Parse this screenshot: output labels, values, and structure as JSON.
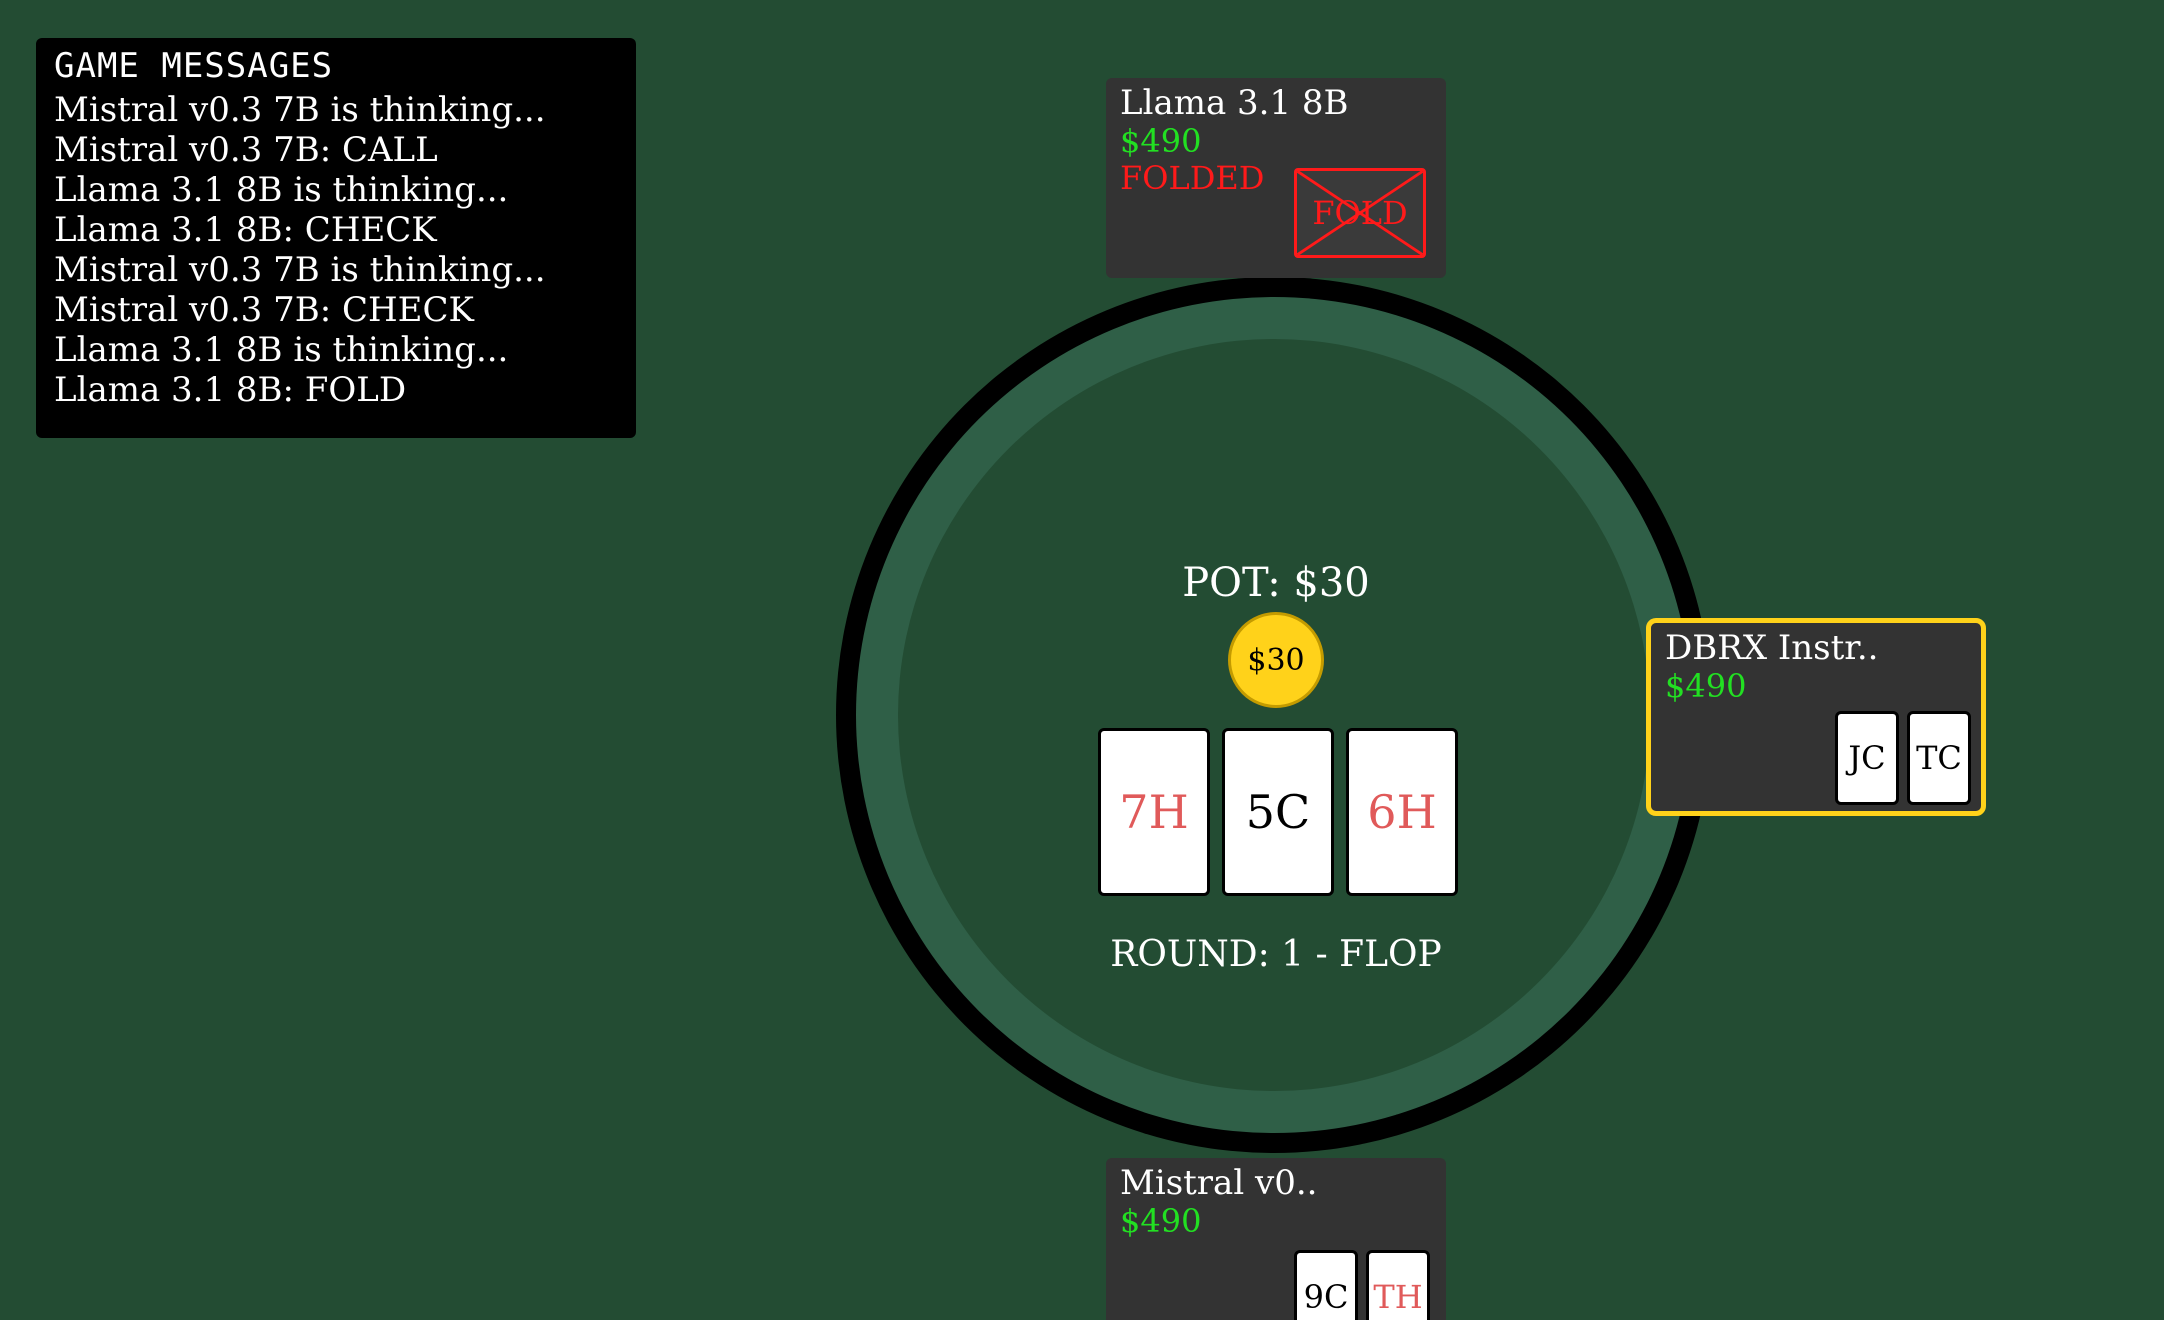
{
  "messages": {
    "title": "GAME MESSAGES",
    "lines": [
      "Mistral v0.3 7B is thinking...",
      "Mistral v0.3 7B: CALL",
      "Llama 3.1 8B is thinking...",
      "Llama 3.1 8B: CHECK",
      "Mistral v0.3 7B is thinking...",
      "Mistral v0.3 7B: CHECK",
      "Llama 3.1 8B is thinking...",
      "Llama 3.1 8B: FOLD"
    ]
  },
  "table": {
    "pot_label": "POT: $30",
    "pot_chip": "$30",
    "community_cards": [
      {
        "label": "7H",
        "color": "#e05a5a"
      },
      {
        "label": "5C",
        "color": "#000000"
      },
      {
        "label": "6H",
        "color": "#e05a5a"
      }
    ],
    "round_label": "ROUND: 1 - FLOP"
  },
  "players": {
    "top": {
      "name": "Llama 3.1 8B",
      "stack": "$490",
      "status": "FOLDED",
      "fold_badge": "FOLD"
    },
    "right": {
      "name": "DBRX Instr..",
      "stack": "$490",
      "cards": [
        {
          "label": "JC",
          "color": "#000000"
        },
        {
          "label": "TC",
          "color": "#000000"
        }
      ]
    },
    "bottom": {
      "name": "Mistral v0..",
      "stack": "$490",
      "cards": [
        {
          "label": "9C",
          "color": "#000000"
        },
        {
          "label": "TH",
          "color": "#e05a5a"
        }
      ]
    }
  },
  "colors": {
    "background": "#234c33",
    "table_rim": "#2f5f47",
    "chip": "#ffd21a",
    "stack_green": "#22e022",
    "fold_red": "#ff1a1a",
    "active_border": "#ffd21a"
  }
}
